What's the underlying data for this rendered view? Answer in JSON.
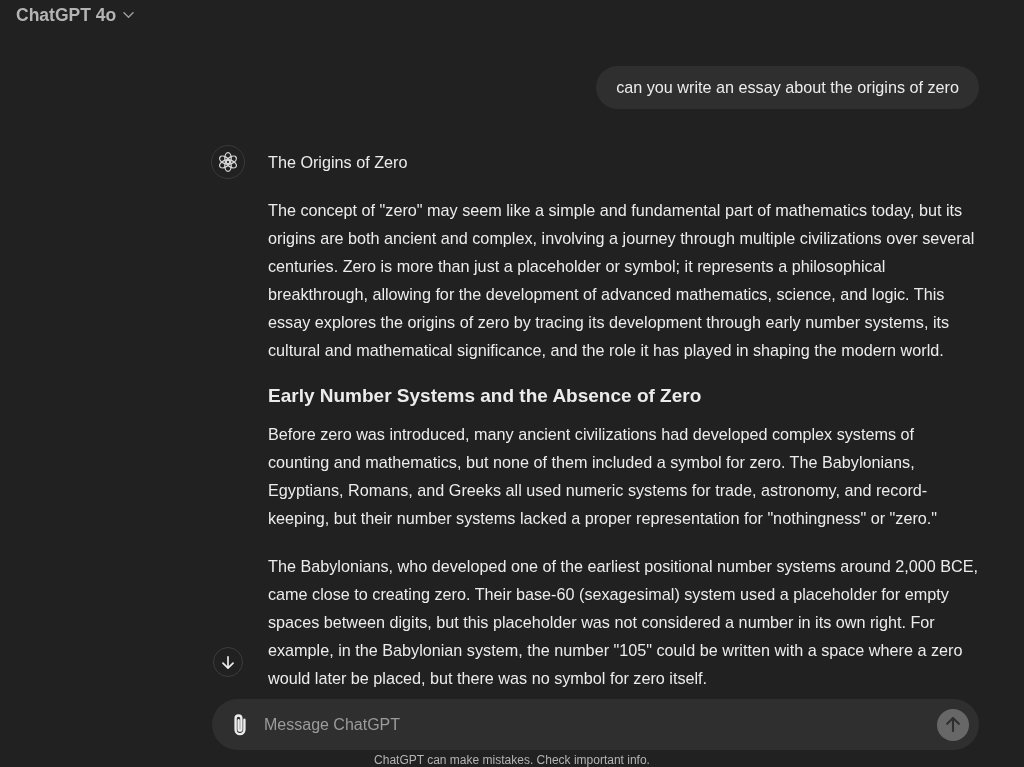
{
  "header": {
    "model_label": "ChatGPT 4o"
  },
  "conversation": {
    "messages": [
      {
        "kind": "user",
        "text": "can you write an essay about the origins of zero"
      },
      {
        "kind": "assistant",
        "blocks": [
          {
            "kind": "title",
            "text": "The Origins of Zero"
          },
          {
            "kind": "paragraph",
            "text": "The concept of \"zero\" may seem like a simple and fundamental part of mathematics today, but its origins are both ancient and complex, involving a journey through multiple civilizations over several centuries. Zero is more than just a placeholder or symbol; it represents a philosophical breakthrough, allowing for the development of advanced mathematics, science, and logic. This essay explores the origins of zero by tracing its development through early number systems, its cultural and mathematical significance, and the role it has played in shaping the modern world."
          },
          {
            "kind": "heading",
            "text": "Early Number Systems and the Absence of Zero"
          },
          {
            "kind": "paragraph",
            "text": "Before zero was introduced, many ancient civilizations had developed complex systems of counting and mathematics, but none of them included a symbol for zero. The Babylonians, Egyptians, Romans, and Greeks all used numeric systems for trade, astronomy, and record-keeping, but their number systems lacked a proper representation for \"nothingness\" or \"zero.\""
          },
          {
            "kind": "paragraph",
            "text": "The Babylonians, who developed one of the earliest positional number systems around 2,000 BCE, came close to creating zero. Their base-60 (sexagesimal) system used a placeholder for empty spaces between digits, but this placeholder was not considered a number in its own right. For example, in the Babylonian system, the number \"105\" could be written with a space where a zero would later be placed, but there was no symbol for zero itself."
          }
        ]
      }
    ]
  },
  "composer": {
    "placeholder": "Message ChatGPT",
    "send_button": {
      "disabled": true
    }
  },
  "footer": {
    "text": "ChatGPT can make mistakes. Check important info."
  }
}
